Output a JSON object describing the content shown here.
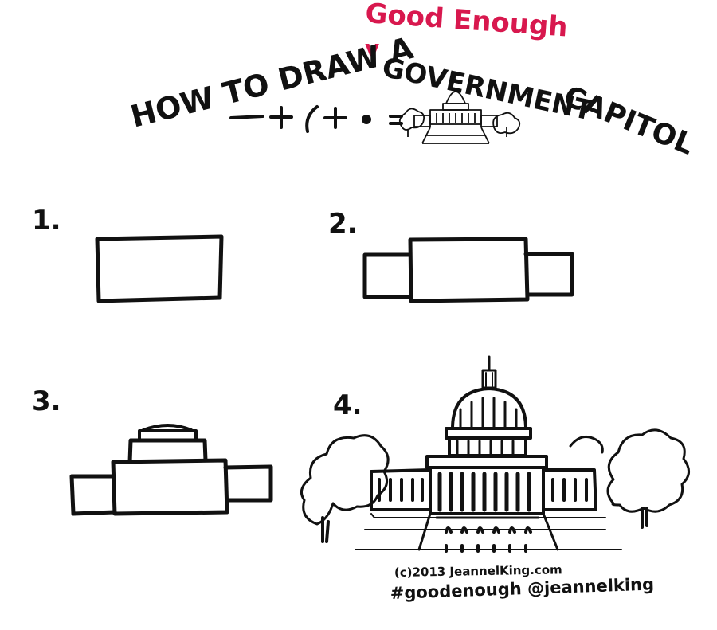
{
  "title": {
    "insert": "Good Enough",
    "line1": "HOW TO DRAW A",
    "word_government": "GOVERNMENT",
    "word_capitol": "CAPITOL",
    "insert_mark": "v"
  },
  "formula": {
    "parts": [
      "—",
      "+",
      "(",
      "+",
      "•",
      "="
    ]
  },
  "steps": [
    {
      "label": "1."
    },
    {
      "label": "2."
    },
    {
      "label": "3."
    },
    {
      "label": "4."
    }
  ],
  "credit": {
    "line1": "(c)2013 JeannelKing.com",
    "line2": "#goodenough @jeannelking"
  },
  "colors": {
    "ink": "#111111",
    "accent": "#d8184e",
    "background": "#ffffff"
  }
}
